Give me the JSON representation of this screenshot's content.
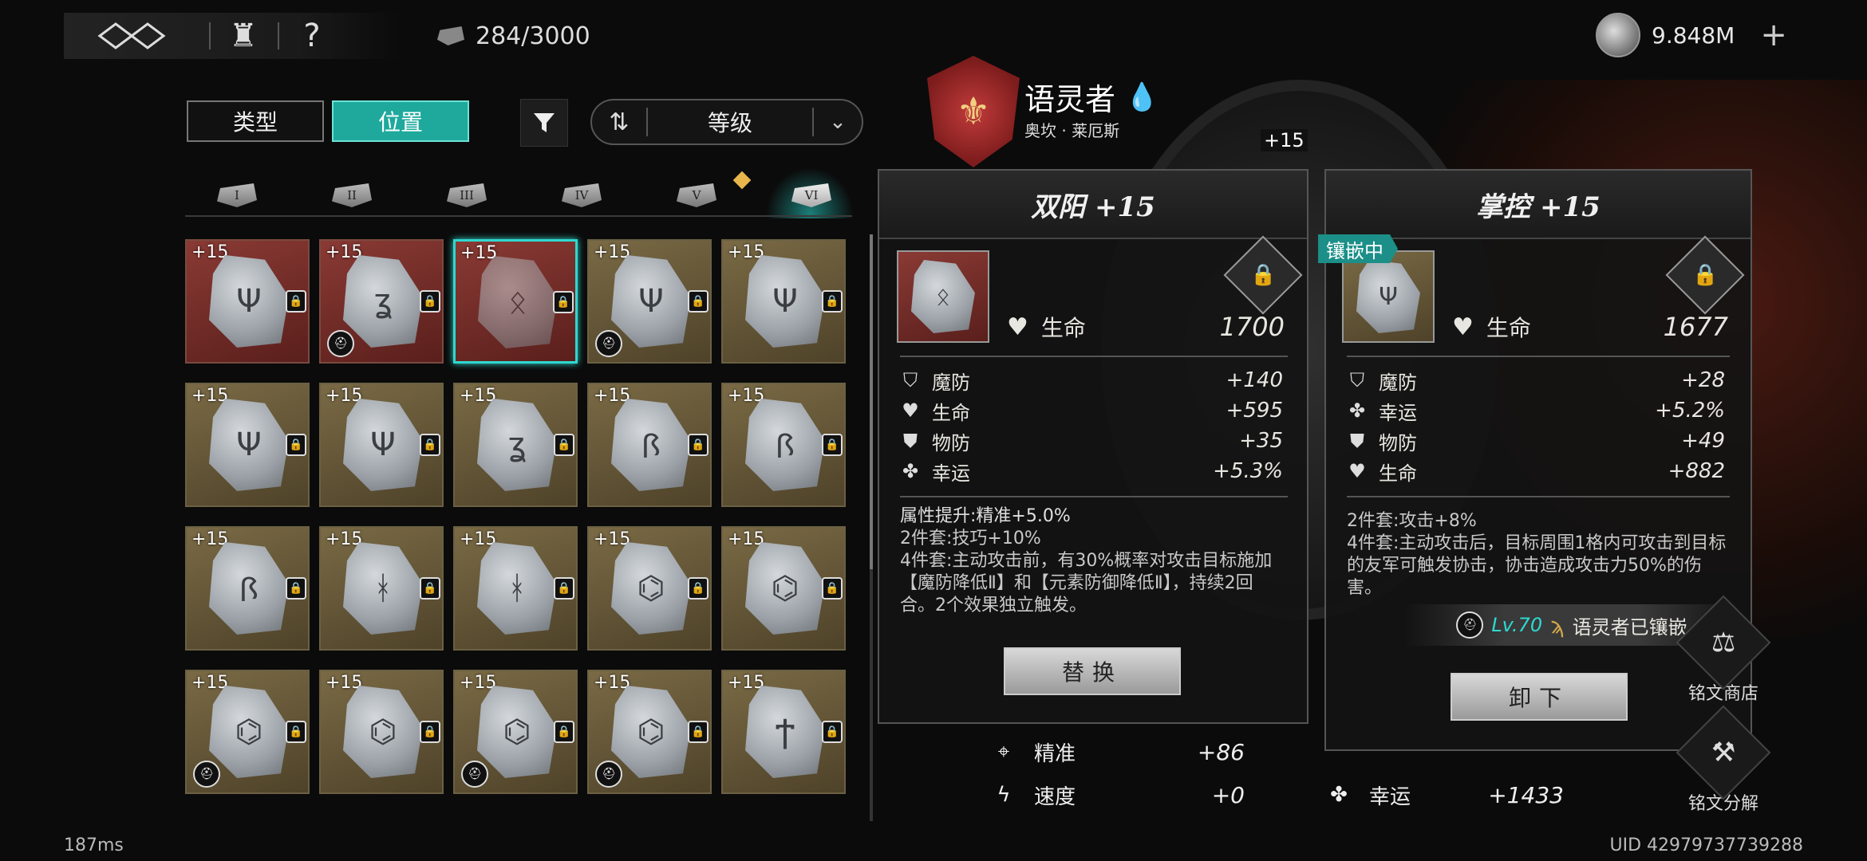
{
  "top": {
    "rune_count": "284/3000",
    "currency": "9.848M",
    "help_label": "?"
  },
  "filter": {
    "type_label": "类型",
    "position_label": "位置",
    "sort_label": "等级"
  },
  "tiers": [
    "I",
    "II",
    "III",
    "IV",
    "V",
    "VI"
  ],
  "grid": [
    [
      {
        "lvl": "+15",
        "bg": "red",
        "glyph": "Ψ",
        "helm": false
      },
      {
        "lvl": "+15",
        "bg": "red",
        "glyph": "ʓ",
        "helm": true
      },
      {
        "lvl": "+15",
        "bg": "red",
        "glyph": "ᛟ",
        "helm": false,
        "selected": true
      },
      {
        "lvl": "+15",
        "bg": "gold",
        "glyph": "Ψ",
        "helm": true
      },
      {
        "lvl": "+15",
        "bg": "gold",
        "glyph": "Ψ",
        "helm": false
      }
    ],
    [
      {
        "lvl": "+15",
        "bg": "gold",
        "glyph": "Ψ",
        "helm": false
      },
      {
        "lvl": "+15",
        "bg": "gold",
        "glyph": "Ψ",
        "helm": false
      },
      {
        "lvl": "+15",
        "bg": "gold",
        "glyph": "ʓ",
        "helm": false
      },
      {
        "lvl": "+15",
        "bg": "gold",
        "glyph": "ꟗ",
        "helm": false
      },
      {
        "lvl": "+15",
        "bg": "gold",
        "glyph": "ꟗ",
        "helm": false
      }
    ],
    [
      {
        "lvl": "+15",
        "bg": "gold",
        "glyph": "ꟗ",
        "helm": false
      },
      {
        "lvl": "+15",
        "bg": "gold",
        "glyph": "ᚼ",
        "helm": false
      },
      {
        "lvl": "+15",
        "bg": "gold",
        "glyph": "ᚼ",
        "helm": false
      },
      {
        "lvl": "+15",
        "bg": "gold",
        "glyph": "⌬",
        "helm": false
      },
      {
        "lvl": "+15",
        "bg": "gold",
        "glyph": "⌬",
        "helm": false
      }
    ],
    [
      {
        "lvl": "+15",
        "bg": "gold",
        "glyph": "⌬",
        "helm": true
      },
      {
        "lvl": "+15",
        "bg": "gold",
        "glyph": "⌬",
        "helm": false
      },
      {
        "lvl": "+15",
        "bg": "gold",
        "glyph": "⌬",
        "helm": true
      },
      {
        "lvl": "+15",
        "bg": "gold",
        "glyph": "⌬",
        "helm": true
      },
      {
        "lvl": "+15",
        "bg": "gold",
        "glyph": "Ϯ",
        "helm": false
      }
    ]
  ],
  "character": {
    "title": "语灵者",
    "subtitle": "奥坎 · 莱厄斯",
    "badge_level": "+15"
  },
  "left_panel": {
    "title": "双阳 +15",
    "main_stat_label": "生命",
    "main_stat_value": "1700",
    "substats": [
      {
        "icon": "magic-def-icon",
        "label": "魔防",
        "value": "+140"
      },
      {
        "icon": "heart-icon",
        "label": "生命",
        "value": "+595"
      },
      {
        "icon": "phys-def-icon",
        "label": "物防",
        "value": "+35"
      },
      {
        "icon": "clover-icon",
        "label": "幸运",
        "value": "+5.3%"
      }
    ],
    "desc_line1": "属性提升:精准+5.0%",
    "desc_line2": "2件套:技巧+10%",
    "desc_line3": "4件套:主动攻击前，有30%概率对攻击目标施加【魔防降低Ⅱ】和【元素防御降低Ⅱ】，持续2回合。2个效果独立触发。",
    "button": "替换"
  },
  "right_panel": {
    "title": "掌控 +15",
    "embed_tag": "镶嵌中",
    "main_stat_label": "生命",
    "main_stat_value": "1677",
    "substats": [
      {
        "icon": "magic-def-icon",
        "label": "魔防",
        "value": "+28"
      },
      {
        "icon": "clover-icon",
        "label": "幸运",
        "value": "+5.2%"
      },
      {
        "icon": "phys-def-icon",
        "label": "物防",
        "value": "+49"
      },
      {
        "icon": "heart-icon",
        "label": "生命",
        "value": "+882"
      }
    ],
    "desc_line1": "2件套:攻击+8%",
    "desc_line2": "4件套:主动攻击后，目标周围1格内可攻击到目标的友军可触发协击，协击造成攻击力50%的伤害。",
    "embed_level": "Lv.70",
    "embed_text": "语灵者已镶嵌",
    "button": "卸下"
  },
  "bottom_stats": {
    "left": [
      {
        "label": "精准",
        "value": "+86"
      },
      {
        "label": "速度",
        "value": "+0"
      }
    ],
    "right": [
      {
        "label": "幸运",
        "value": "+1433"
      }
    ]
  },
  "side": {
    "shop_label": "铭文商店",
    "decompose_label": "铭文分解"
  },
  "footer": {
    "ping": "187ms",
    "uid": "UID 42979737739288"
  },
  "colors": {
    "accent": "#1ea99c",
    "selected": "#2fd8d0",
    "embed_level": "#2fd8d0"
  }
}
